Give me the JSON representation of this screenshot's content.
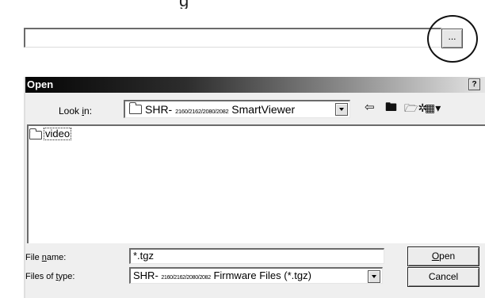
{
  "caption_fragment": "g",
  "path_field": {
    "value": ""
  },
  "browse_button": {
    "label": "..."
  },
  "dialog": {
    "title": "Open",
    "help_label": "?",
    "look_in": {
      "label_pre": "Look ",
      "label_key": "i",
      "label_post": "n:",
      "prefix": "SHR- ",
      "model_numbers": "2160/2162/2080/2082",
      "folder_name": " SmartViewer"
    },
    "toolbar_icons": [
      "back-arrow-icon",
      "up-folder-icon",
      "new-folder-icon",
      "views-menu-icon"
    ],
    "file_list": [
      {
        "name": "video",
        "icon": "folder-icon"
      }
    ],
    "file_name": {
      "label_pre": "File ",
      "label_key": "n",
      "label_post": "ame:",
      "value": "*.tgz"
    },
    "file_type": {
      "label_pre": "Files of ",
      "label_key": "t",
      "label_post": "ype:",
      "prefix": "SHR- ",
      "model_numbers": "2160/2162/2080/2082",
      "suffix": " Firmware Files (*.tgz)"
    },
    "open_button": {
      "key": "O",
      "rest": "pen"
    },
    "cancel_button": {
      "label": "Cancel"
    }
  }
}
